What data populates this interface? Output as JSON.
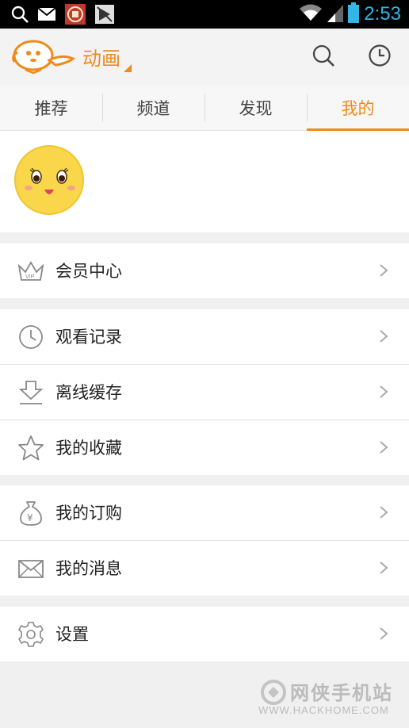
{
  "status_bar": {
    "time": "2:53"
  },
  "app_bar": {
    "title": "动画"
  },
  "tabs": [
    {
      "label": "推荐",
      "active": false
    },
    {
      "label": "频道",
      "active": false
    },
    {
      "label": "发现",
      "active": false
    },
    {
      "label": "我的",
      "active": true
    }
  ],
  "menu": {
    "vip": {
      "label": "会员中心",
      "icon": "crown-vip-icon"
    },
    "history": {
      "label": "观看记录",
      "icon": "clock-icon"
    },
    "offline": {
      "label": "离线缓存",
      "icon": "download-icon"
    },
    "favorites": {
      "label": "我的收藏",
      "icon": "star-icon"
    },
    "subscriptions": {
      "label": "我的订购",
      "icon": "money-bag-icon"
    },
    "messages": {
      "label": "我的消息",
      "icon": "envelope-icon"
    },
    "settings": {
      "label": "设置",
      "icon": "gear-icon"
    }
  },
  "watermark": {
    "name": "网侠手机站",
    "url": "WWW.HACKHOME.COM"
  },
  "colors": {
    "accent": "#f08a1c",
    "status_time": "#33b5e5",
    "background": "#f0f0f0"
  }
}
